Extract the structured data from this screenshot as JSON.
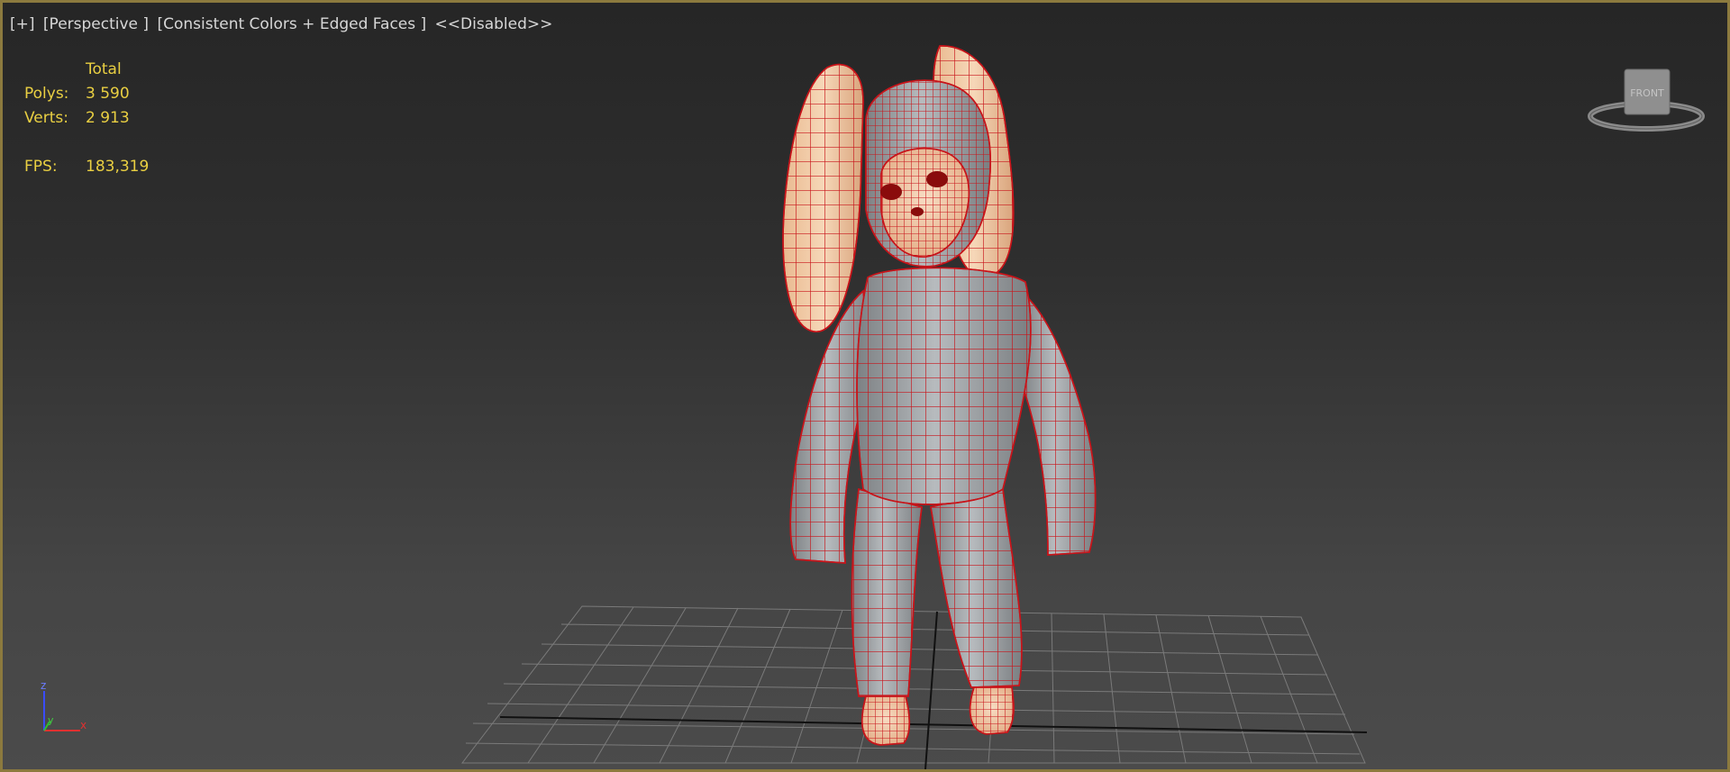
{
  "viewport": {
    "labels": {
      "plus": "[+]",
      "view": "[Perspective ]",
      "shading": "[Consistent Colors + Edged Faces ]",
      "disabled": "<<Disabled>>"
    }
  },
  "stats": {
    "header": "Total",
    "polys_label": "Polys:",
    "polys_value": "3 590",
    "verts_label": "Verts:",
    "verts_value": "2 913",
    "fps_label": "FPS:",
    "fps_value": "183,319"
  },
  "viewcube": {
    "face": "FRONT"
  },
  "axis": {
    "z": "z",
    "y": "y",
    "x": "x"
  },
  "colors": {
    "border_active": "#8c7a3e",
    "stats_text": "#e9cf42",
    "wire": "#c8141a",
    "body_gray": "#9ea3a6",
    "skin": "#f2c9a3"
  }
}
